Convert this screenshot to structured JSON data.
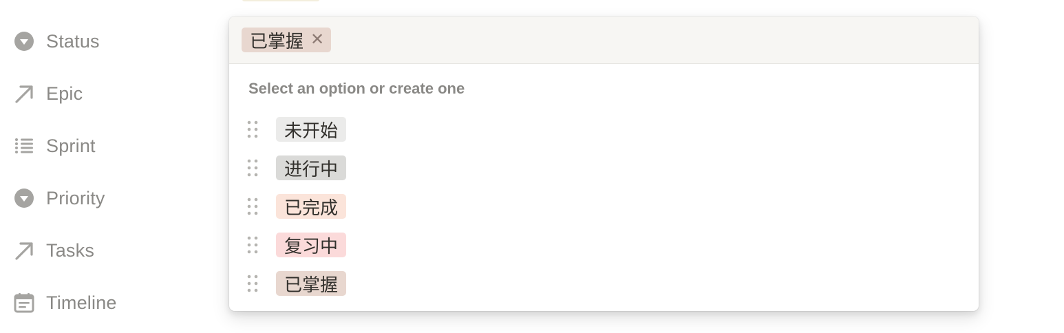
{
  "properties": [
    {
      "label": "Status",
      "icon": "status-select-icon"
    },
    {
      "label": "Epic",
      "icon": "relation-arrow-icon"
    },
    {
      "label": "Sprint",
      "icon": "list-icon"
    },
    {
      "label": "Priority",
      "icon": "priority-select-icon"
    },
    {
      "label": "Tasks",
      "icon": "relation-arrow-icon"
    },
    {
      "label": "Timeline",
      "icon": "calendar-icon"
    }
  ],
  "dropdown": {
    "selected": {
      "label": "已掌握",
      "remove_glyph": "✕",
      "color": "#e8d7cf"
    },
    "hint": "Select an option or create one",
    "options": [
      {
        "label": "未开始",
        "color": "#ebebea"
      },
      {
        "label": "进行中",
        "color": "#dadad8"
      },
      {
        "label": "已完成",
        "color": "#fbe4da"
      },
      {
        "label": "复习中",
        "color": "#fbdada"
      },
      {
        "label": "已掌握",
        "color": "#e8d7cf"
      }
    ]
  }
}
